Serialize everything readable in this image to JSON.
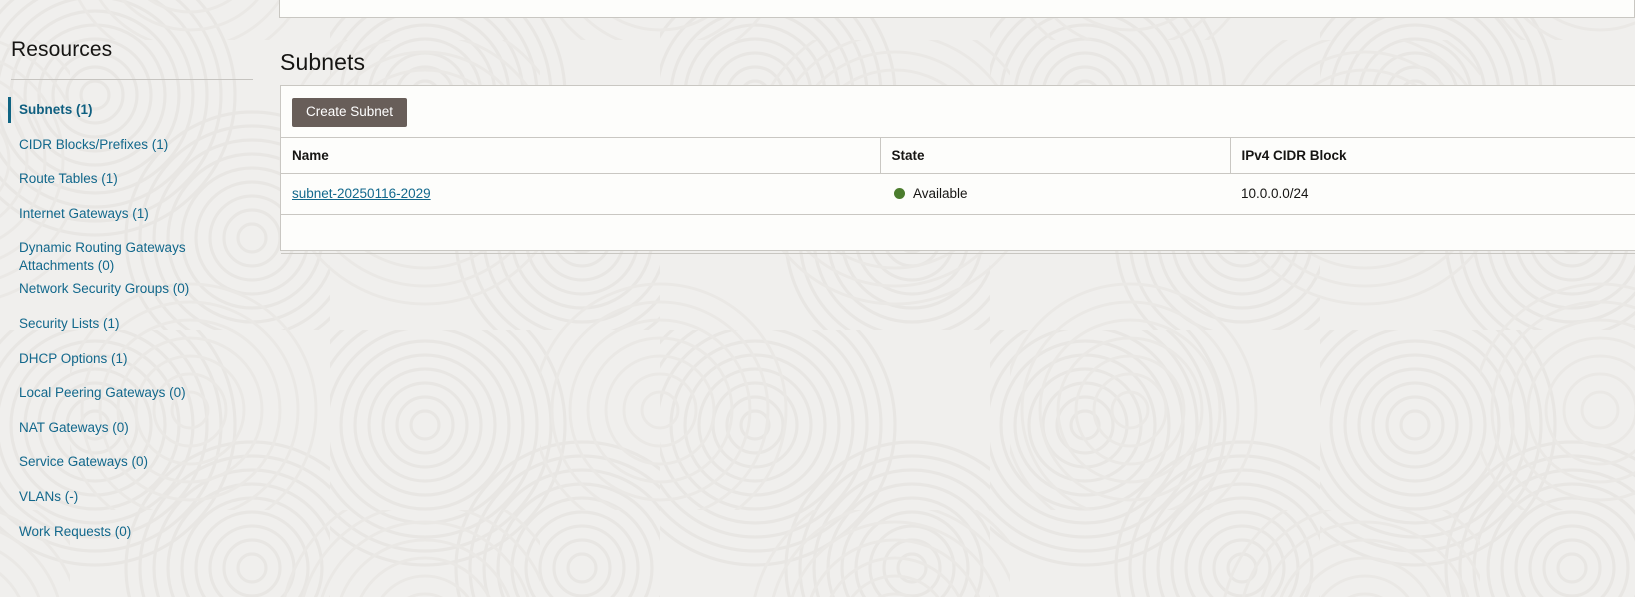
{
  "theme": {
    "page_background": "#f0efed",
    "panel_background": "#fdfdfb",
    "border": "#c9c7c2",
    "link": "#12688c",
    "accent_bar": "#0f6483",
    "button_background": "#685e59",
    "status_available": "#4b7c2d",
    "heading_text": "#161513"
  },
  "sidebar": {
    "title": "Resources",
    "items": [
      {
        "label": "Subnets (1)",
        "name": "Subnets",
        "count": "1",
        "selected": true
      },
      {
        "label": "CIDR Blocks/Prefixes (1)",
        "name": "CIDR Blocks/Prefixes",
        "count": "1",
        "selected": false
      },
      {
        "label": "Route Tables (1)",
        "name": "Route Tables",
        "count": "1",
        "selected": false
      },
      {
        "label": "Internet Gateways (1)",
        "name": "Internet Gateways",
        "count": "1",
        "selected": false
      },
      {
        "label": "Dynamic Routing Gateways Attachments (0)",
        "name": "Dynamic Routing Gateways Attachments",
        "count": "0",
        "selected": false
      },
      {
        "label": "Network Security Groups (0)",
        "name": "Network Security Groups",
        "count": "0",
        "selected": false
      },
      {
        "label": "Security Lists (1)",
        "name": "Security Lists",
        "count": "1",
        "selected": false
      },
      {
        "label": "DHCP Options (1)",
        "name": "DHCP Options",
        "count": "1",
        "selected": false
      },
      {
        "label": "Local Peering Gateways (0)",
        "name": "Local Peering Gateways",
        "count": "0",
        "selected": false
      },
      {
        "label": "NAT Gateways (0)",
        "name": "NAT Gateways",
        "count": "0",
        "selected": false
      },
      {
        "label": "Service Gateways (0)",
        "name": "Service Gateways",
        "count": "0",
        "selected": false
      },
      {
        "label": "VLANs (-)",
        "name": "VLANs",
        "count": "-",
        "selected": false
      },
      {
        "label": "Work Requests (0)",
        "name": "Work Requests",
        "count": "0",
        "selected": false
      }
    ]
  },
  "main": {
    "page_title": "Subnets",
    "toolbar": {
      "create_label": "Create Subnet"
    },
    "table": {
      "columns": [
        "Name",
        "State",
        "IPv4 CIDR Block"
      ],
      "rows": [
        {
          "name": "subnet-20250116-2029",
          "state": "Available",
          "state_icon": "status-dot-green",
          "cidr": "10.0.0.0/24"
        }
      ]
    }
  }
}
